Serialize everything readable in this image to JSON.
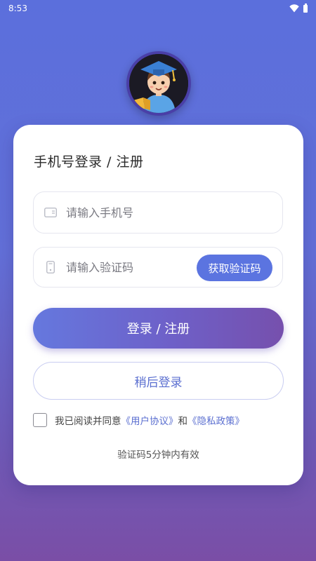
{
  "status_bar": {
    "time": "8:53"
  },
  "avatar": {
    "icon": "graduate-boy-avatar"
  },
  "card": {
    "title": "手机号登录 / 注册",
    "phone_field": {
      "placeholder": "请输入手机号",
      "icon": "phone-card-icon"
    },
    "code_field": {
      "placeholder": "请输入验证码",
      "icon": "sms-lock-icon"
    },
    "get_code_label": "获取验证码",
    "login_label": "登录 / 注册",
    "later_label": "稍后登录",
    "agreement": {
      "prefix": "我已阅读并同意",
      "user_agreement": "《用户协议》",
      "and": "和",
      "privacy_policy": "《隐私政策》"
    },
    "note": "验证码5分钟内有效"
  },
  "colors": {
    "accent": "#5b74e0",
    "link": "#5b6fd0",
    "gradient_top": "#5b6fdc",
    "gradient_bottom": "#7a4ea6"
  }
}
